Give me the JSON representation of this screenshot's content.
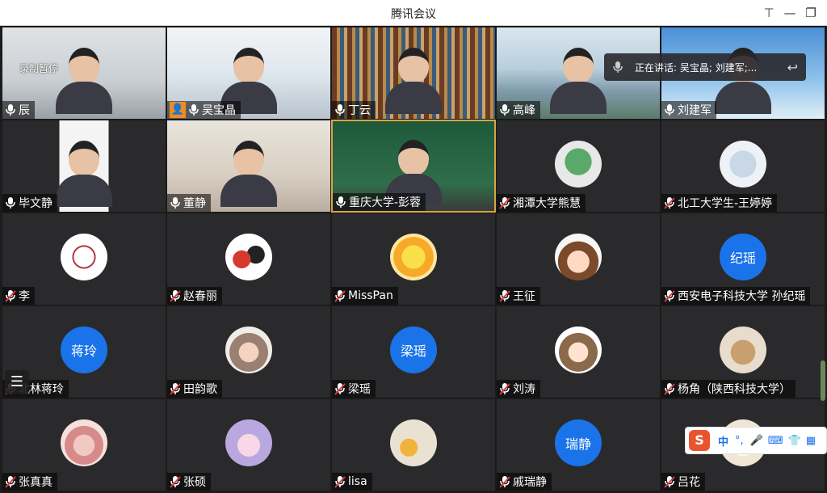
{
  "window": {
    "title": "腾讯会议",
    "controls": {
      "pin": "⊤",
      "minimize": "—",
      "restore": "❐",
      "close": "✕"
    }
  },
  "recording_status": "录制暂停",
  "speaking_now": "正在讲话: 吴宝晶; 刘建军;...",
  "participants": [
    {
      "name": "辰",
      "kind": "video",
      "scene": "office"
    },
    {
      "name": "吴宝晶",
      "kind": "video",
      "scene": "bright-room",
      "host": true
    },
    {
      "name": "丁云",
      "kind": "video",
      "scene": "bookshelf"
    },
    {
      "name": "高峰",
      "kind": "video",
      "scene": "lake"
    },
    {
      "name": "刘建军",
      "kind": "video",
      "scene": "sky"
    },
    {
      "name": "毕文静",
      "kind": "video",
      "scene": "portrait"
    },
    {
      "name": "董静",
      "kind": "video",
      "scene": "shelf"
    },
    {
      "name": "重庆大学-彭蓉",
      "kind": "video",
      "scene": "blackboard",
      "active": true
    },
    {
      "name": "湘潭大学熊慧",
      "kind": "avatar-image",
      "avatar": "frog"
    },
    {
      "name": "北工大学生-王婷婷",
      "kind": "avatar-image",
      "avatar": "pale"
    },
    {
      "name": "李",
      "kind": "avatar-image",
      "avatar": "seal"
    },
    {
      "name": "赵春丽",
      "kind": "avatar-image",
      "avatar": "panda"
    },
    {
      "name": "MissPan",
      "kind": "avatar-image",
      "avatar": "sun"
    },
    {
      "name": "王征",
      "kind": "avatar-image",
      "avatar": "cartoon-boy"
    },
    {
      "name": "西安电子科技大学 孙纪瑶",
      "kind": "avatar-text",
      "avatar_text": "纪瑶"
    },
    {
      "name": "北林蒋玲",
      "kind": "avatar-text",
      "avatar_text": "蒋玲"
    },
    {
      "name": "田韵歌",
      "kind": "avatar-image",
      "avatar": "girl-art"
    },
    {
      "name": "梁瑶",
      "kind": "avatar-text",
      "avatar_text": "梁瑶"
    },
    {
      "name": "刘涛",
      "kind": "avatar-image",
      "avatar": "cartoon-girl"
    },
    {
      "name": "杨角（陕西科技大学）",
      "kind": "avatar-image",
      "avatar": "teddy"
    },
    {
      "name": "张真真",
      "kind": "avatar-image",
      "avatar": "pink-girl"
    },
    {
      "name": "张硕",
      "kind": "avatar-image",
      "avatar": "pink-cat"
    },
    {
      "name": "lisa",
      "kind": "avatar-image",
      "avatar": "sunflower"
    },
    {
      "name": "戚瑞静",
      "kind": "avatar-text",
      "avatar_text": "瑞静"
    },
    {
      "name": "吕花",
      "kind": "avatar-image",
      "avatar": "light"
    }
  ],
  "ime_toolbar": {
    "logo": "S",
    "mode": "中",
    "punct": "°,"
  },
  "colors": {
    "accent": "#1a73e8",
    "active_border": "#d9a441",
    "muted_mic": "#e0393e"
  }
}
